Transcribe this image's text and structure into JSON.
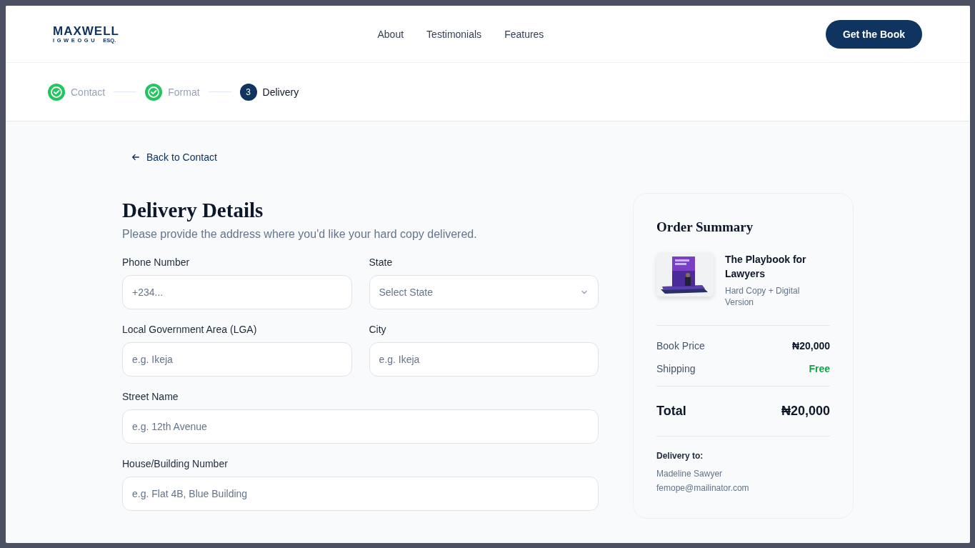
{
  "logo": {
    "name": "MAXWELL",
    "subtitle": "IGWEOGU",
    "suffix": "ESQ."
  },
  "nav": [
    "About",
    "Testimonials",
    "Features"
  ],
  "cta": "Get the Book",
  "steps": [
    {
      "label": "Contact",
      "completed": true,
      "selected": false
    },
    {
      "label": "Format",
      "completed": true,
      "selected": false
    },
    {
      "label": "Delivery",
      "number": "3",
      "completed": false,
      "selected": true
    }
  ],
  "back_link": "Back to Contact",
  "form": {
    "title": "Delivery Details",
    "subtitle": "Please provide the address where you'd like your hard copy delivered.",
    "rows": [
      [
        {
          "label": "Phone Number",
          "placeholder": "+234...",
          "kind": "text"
        },
        {
          "label": "State",
          "placeholder": "Select State",
          "kind": "select"
        }
      ],
      [
        {
          "label": "Local Government Area (LGA)",
          "placeholder": "e.g. Ikeja",
          "kind": "text"
        },
        {
          "label": "City",
          "placeholder": "e.g. Ikeja",
          "kind": "text"
        }
      ],
      [
        {
          "label": "Street Name",
          "placeholder": "e.g. 12th Avenue",
          "kind": "text"
        }
      ],
      [
        {
          "label": "House/Building Number",
          "placeholder": "e.g. Flat 4B, Blue Building",
          "kind": "text"
        }
      ]
    ]
  },
  "summary": {
    "title": "Order Summary",
    "product": {
      "kind": "picture",
      "name": "The Playbook for Lawyers",
      "variant": "Hard Copy + Digital Version"
    },
    "lines": [
      {
        "label": "Book Price",
        "value": "₦20,000",
        "kind": "normal"
      },
      {
        "label": "Shipping",
        "value": "Free",
        "kind": "free"
      }
    ],
    "total": {
      "label": "Total",
      "value": "₦20,000"
    },
    "delivery_heading": "Delivery to:",
    "delivery_lines": [
      "Madeline Sawyer",
      "femope@mailinator.com"
    ]
  }
}
